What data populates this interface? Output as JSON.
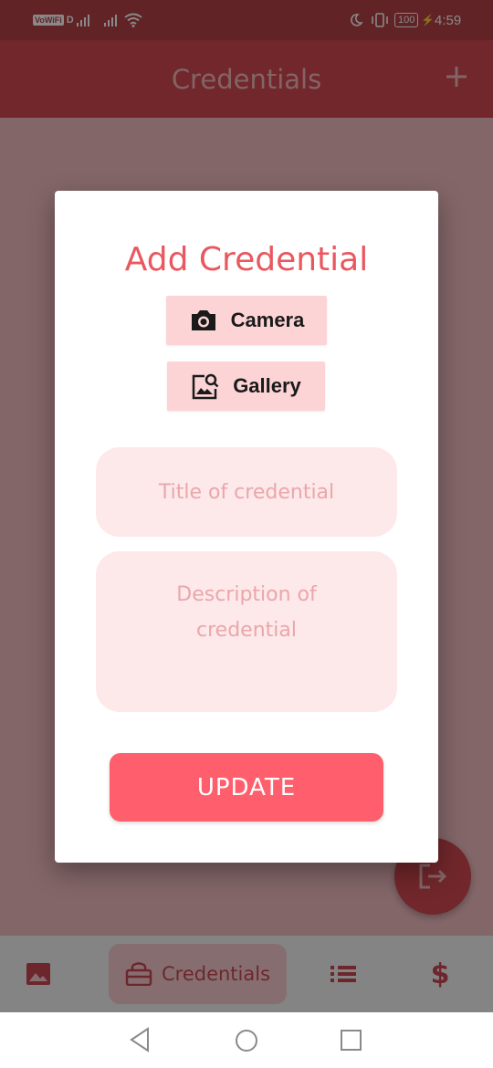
{
  "status_bar": {
    "carrier_badge": "VoWiFi",
    "carrier_suffix": "D",
    "battery": "100",
    "time": "4:59"
  },
  "app_bar": {
    "title": "Credentials"
  },
  "dialog": {
    "title": "Add Credential",
    "camera_label": "Camera",
    "gallery_label": "Gallery",
    "title_placeholder": "Title of credential",
    "description_placeholder": "Description of credential",
    "update_label": "UPDATE"
  },
  "bottom_nav": {
    "items": [
      {
        "icon": "image-icon"
      },
      {
        "icon": "credentials-icon",
        "label": "Credentials",
        "active": true
      },
      {
        "icon": "list-icon"
      },
      {
        "icon": "dollar-icon",
        "label": "$"
      }
    ]
  },
  "colors": {
    "primary": "#cf3b43",
    "accent_title": "#e9575f",
    "button_fill": "#ff5f6c",
    "chip_fill": "#fdd4d6",
    "field_fill": "#fde8ea"
  }
}
